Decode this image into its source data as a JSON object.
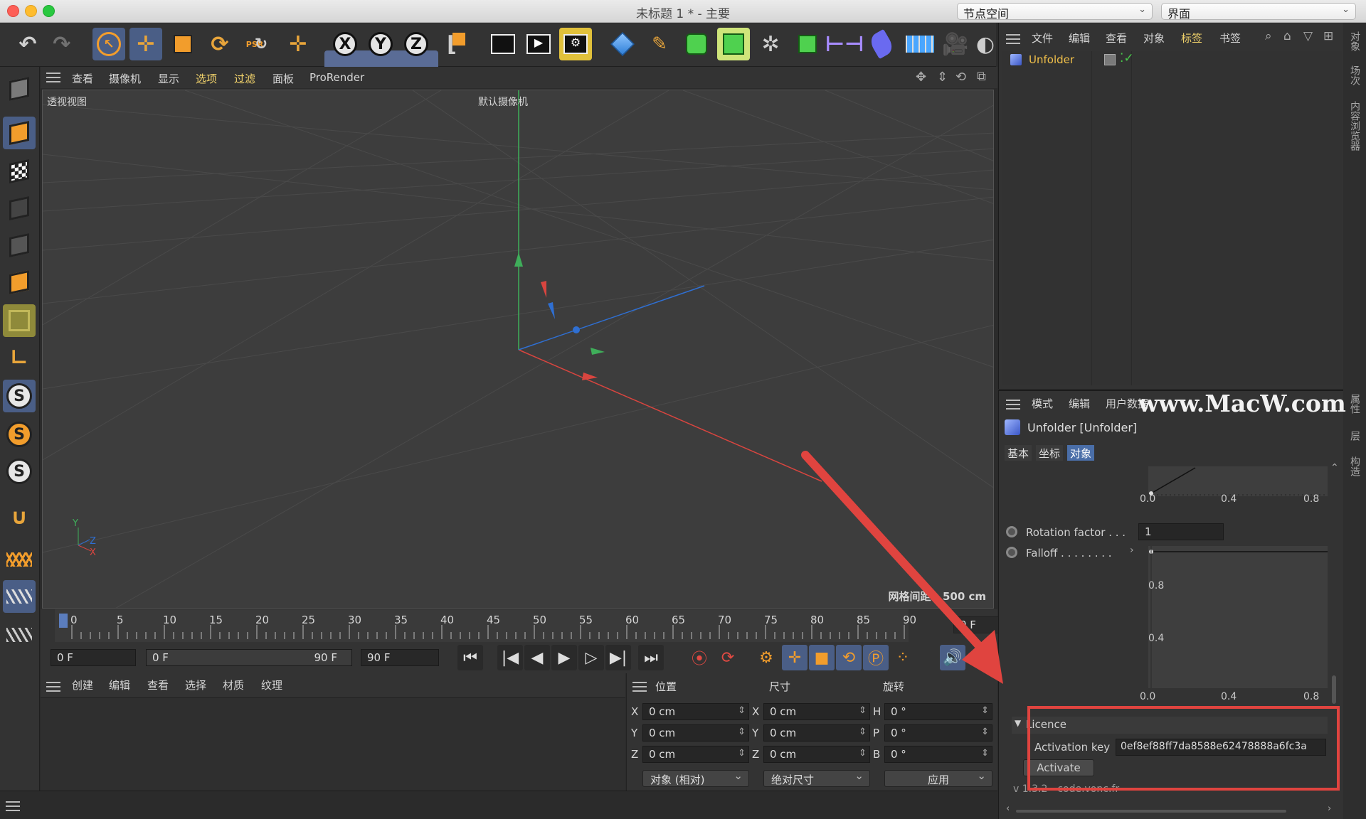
{
  "window": {
    "title": "未标题 1 * - 主要",
    "layout_select": "节点空间",
    "interface_select": "界面"
  },
  "toolbar": {
    "icons": [
      "undo-icon",
      "redo-icon",
      "select-icon",
      "move-icon",
      "scale-icon",
      "rotate-icon",
      "psr-icon",
      "transform-icon",
      "x-axis-icon",
      "y-axis-icon",
      "z-axis-icon",
      "coord-system-icon",
      "render-view-icon",
      "render-icon",
      "render-settings-icon",
      "cube-icon",
      "pen-icon",
      "subdivision-icon",
      "extrude-icon",
      "cloner-icon",
      "generator-icon",
      "deformer-icon",
      "spline-icon",
      "floor-icon",
      "camera-icon",
      "light-icon"
    ],
    "axis_labels": [
      "X",
      "Y",
      "Z"
    ],
    "psr_label": "PSR"
  },
  "viewport": {
    "menu": [
      "查看",
      "摄像机",
      "显示",
      "选项",
      "过滤",
      "面板",
      "ProRender"
    ],
    "label": "透视视图",
    "camera": "默认摄像机",
    "grid_spacing": "网格间距 : 500 cm",
    "axis_labels": {
      "y": "Y",
      "z": "Z",
      "x": "X"
    }
  },
  "timeline": {
    "ticks": [
      "0",
      "5",
      "10",
      "15",
      "20",
      "25",
      "30",
      "35",
      "40",
      "45",
      "50",
      "55",
      "60",
      "65",
      "70",
      "75",
      "80",
      "85",
      "90"
    ],
    "current_frame": "0 F",
    "start_frame": "0 F",
    "range_start": "0 F",
    "range_end": "90 F",
    "end_frame": "90 F"
  },
  "material_panel": {
    "menu": [
      "创建",
      "编辑",
      "查看",
      "选择",
      "材质",
      "纹理"
    ]
  },
  "coord_panel": {
    "headers": [
      "位置",
      "尺寸",
      "旋转"
    ],
    "rows": [
      {
        "pl": "X",
        "pv": "0 cm",
        "sl": "X",
        "sv": "0 cm",
        "rl": "H",
        "rv": "0 °"
      },
      {
        "pl": "Y",
        "pv": "0 cm",
        "sl": "Y",
        "sv": "0 cm",
        "rl": "P",
        "rv": "0 °"
      },
      {
        "pl": "Z",
        "pv": "0 cm",
        "sl": "Z",
        "sv": "0 cm",
        "rl": "B",
        "rv": "0 °"
      }
    ],
    "mode_select": "对象 (相对)",
    "size_select": "绝对尺寸",
    "apply": "应用"
  },
  "object_manager": {
    "menu": [
      "文件",
      "编辑",
      "查看",
      "对象",
      "标签",
      "书签"
    ],
    "object_name": "Unfolder"
  },
  "attribute_manager": {
    "menu": [
      "模式",
      "编辑",
      "用户数据"
    ],
    "title": "Unfolder [Unfolder]",
    "tabs": [
      "基本",
      "坐标",
      "对象"
    ],
    "graph1_ticks": [
      "0.0",
      "0.4",
      "0.8"
    ],
    "rotation_factor_label": "Rotation factor . . .",
    "rotation_factor_value": "1",
    "falloff_label": "Falloff . . . . . . . .",
    "graph2_yticks": [
      "0.8",
      "0.4"
    ],
    "graph2_xticks": [
      "0.0",
      "0.4",
      "0.8"
    ],
    "licence_header": "Licence",
    "activation_label": "Activation key",
    "activation_value": "0ef8ef88ff7da8588e62478888a6fc3a",
    "activate_button": "Activate",
    "version": "v 1.3.2 - code.vonc.fr"
  },
  "right_strip": [
    "对象",
    "场次",
    "内容浏览器",
    "属性",
    "层",
    "构造"
  ],
  "watermark": "www.MacW.com",
  "colors": {
    "accent": "#4a6ea8",
    "highlight_text": "#f2d36b",
    "annotation_red": "#e0443f",
    "orange": "#f29d2c"
  }
}
